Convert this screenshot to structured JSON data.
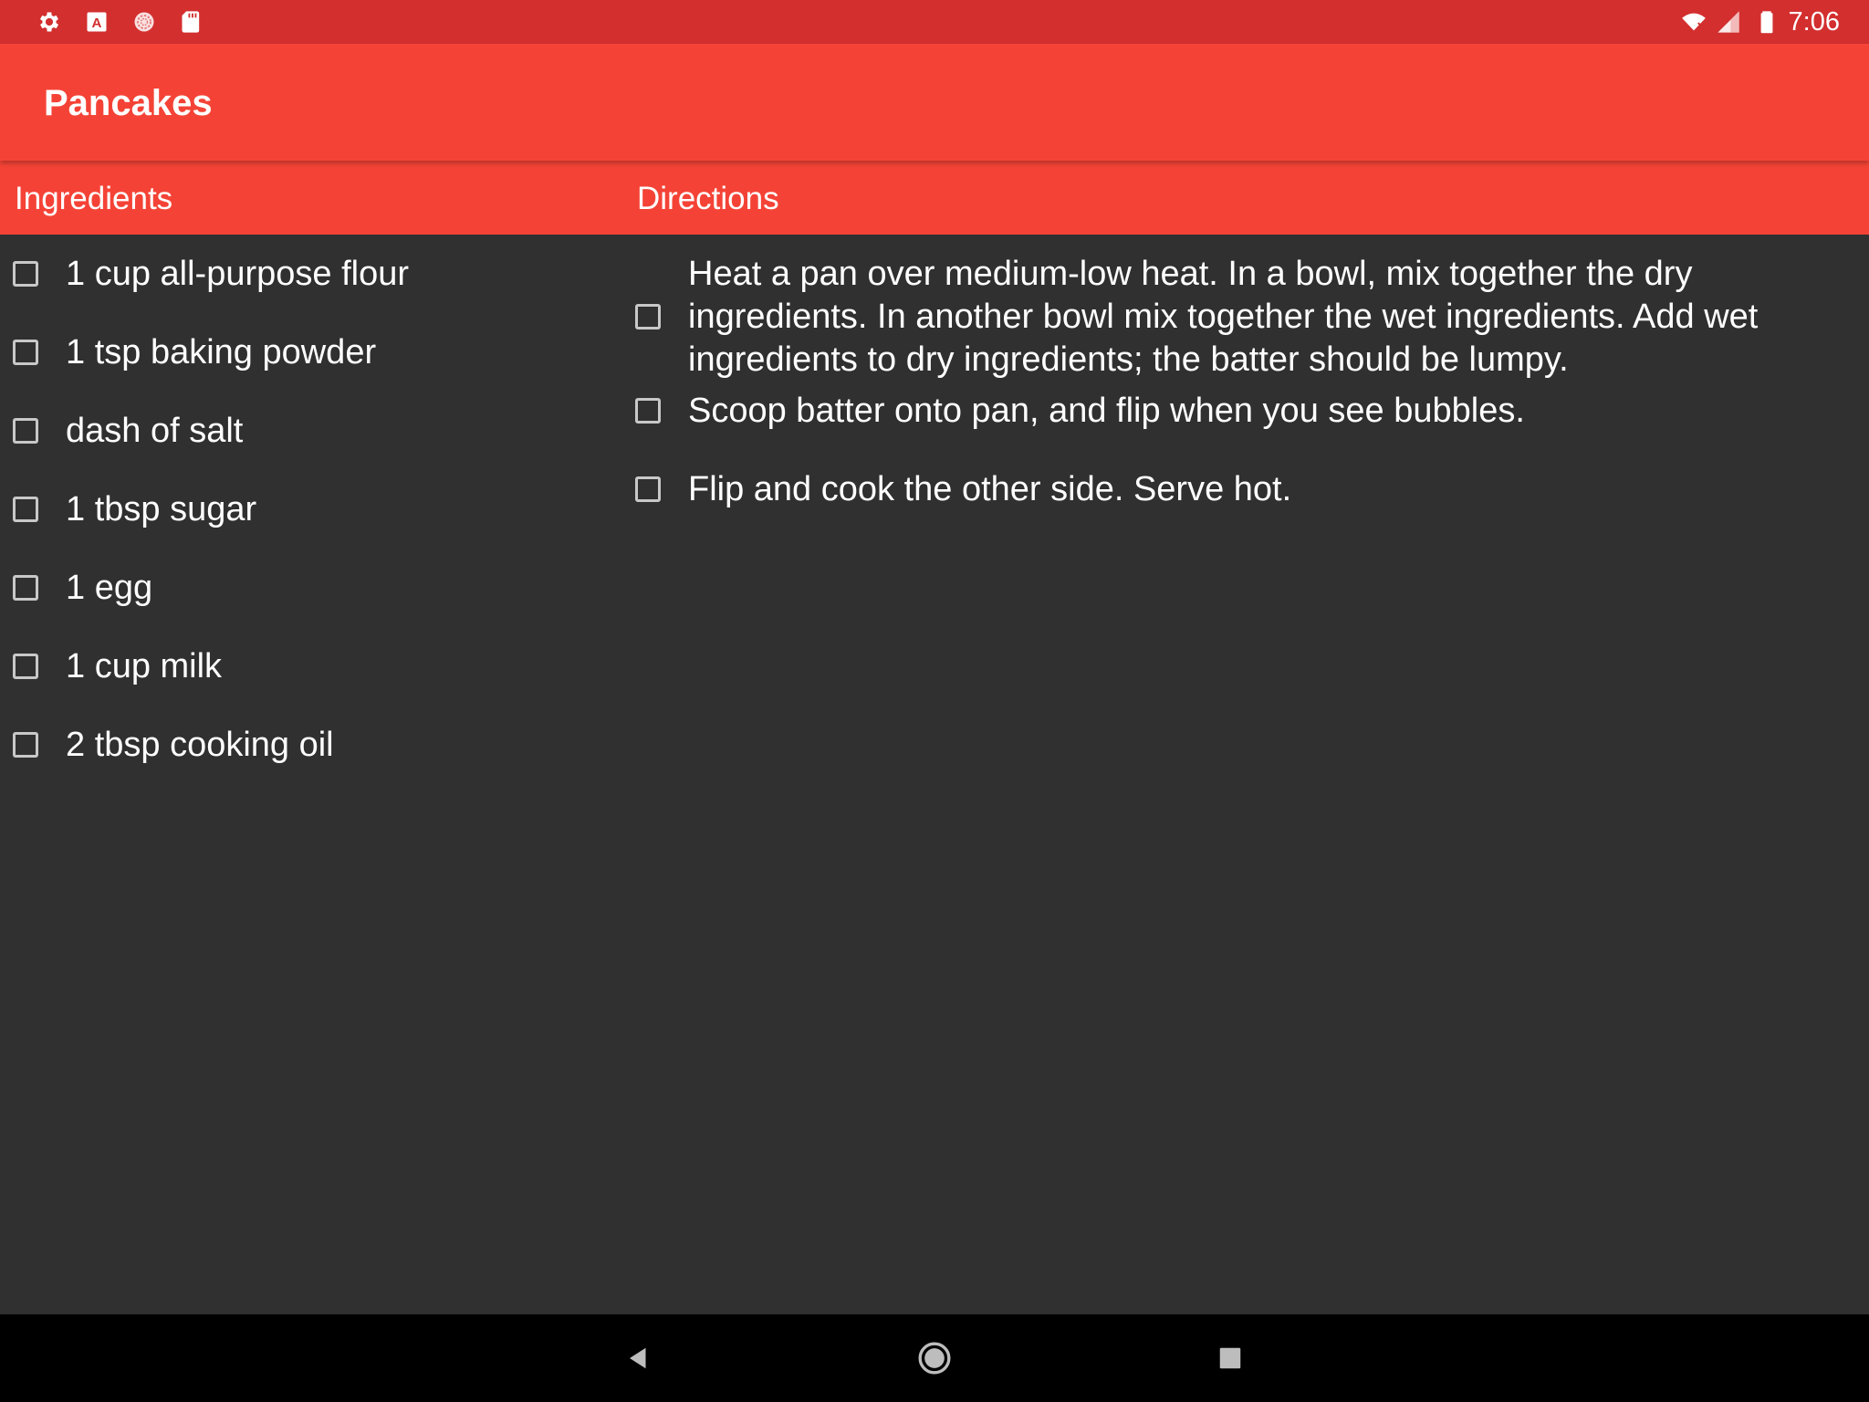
{
  "status_bar": {
    "time": "7:06",
    "left_icons": [
      "settings-icon",
      "font-a-icon",
      "sync-circle-icon",
      "sd-card-icon"
    ],
    "right_icons": [
      "wifi-icon",
      "signal-icon",
      "battery-icon"
    ]
  },
  "app_bar": {
    "title": "Pancakes",
    "color": "#f44336"
  },
  "sections": {
    "ingredients_label": "Ingredients",
    "directions_label": "Directions"
  },
  "ingredients": [
    {
      "text": "1 cup all-purpose flour",
      "checked": false
    },
    {
      "text": "1 tsp baking powder",
      "checked": false
    },
    {
      "text": "dash of salt",
      "checked": false
    },
    {
      "text": "1 tbsp sugar",
      "checked": false
    },
    {
      "text": "1 egg",
      "checked": false
    },
    {
      "text": "1 cup milk",
      "checked": false
    },
    {
      "text": "2 tbsp cooking oil",
      "checked": false
    }
  ],
  "directions": [
    {
      "text": "Heat a pan over medium-low heat. In a bowl, mix together the dry ingredients. In another bowl mix together the wet ingredients. Add wet ingredients to dry ingredients; the batter should be lumpy.",
      "checked": false
    },
    {
      "text": "Scoop batter onto pan, and flip when you see bubbles.",
      "checked": false
    },
    {
      "text": "Flip and cook the other side. Serve hot.",
      "checked": false
    }
  ],
  "nav_bar": {
    "buttons": [
      "back-icon",
      "home-icon",
      "recents-icon"
    ]
  },
  "colors": {
    "status_bar": "#d32f2f",
    "app_bar": "#f44336",
    "background": "#303030",
    "text": "#ffffff"
  }
}
